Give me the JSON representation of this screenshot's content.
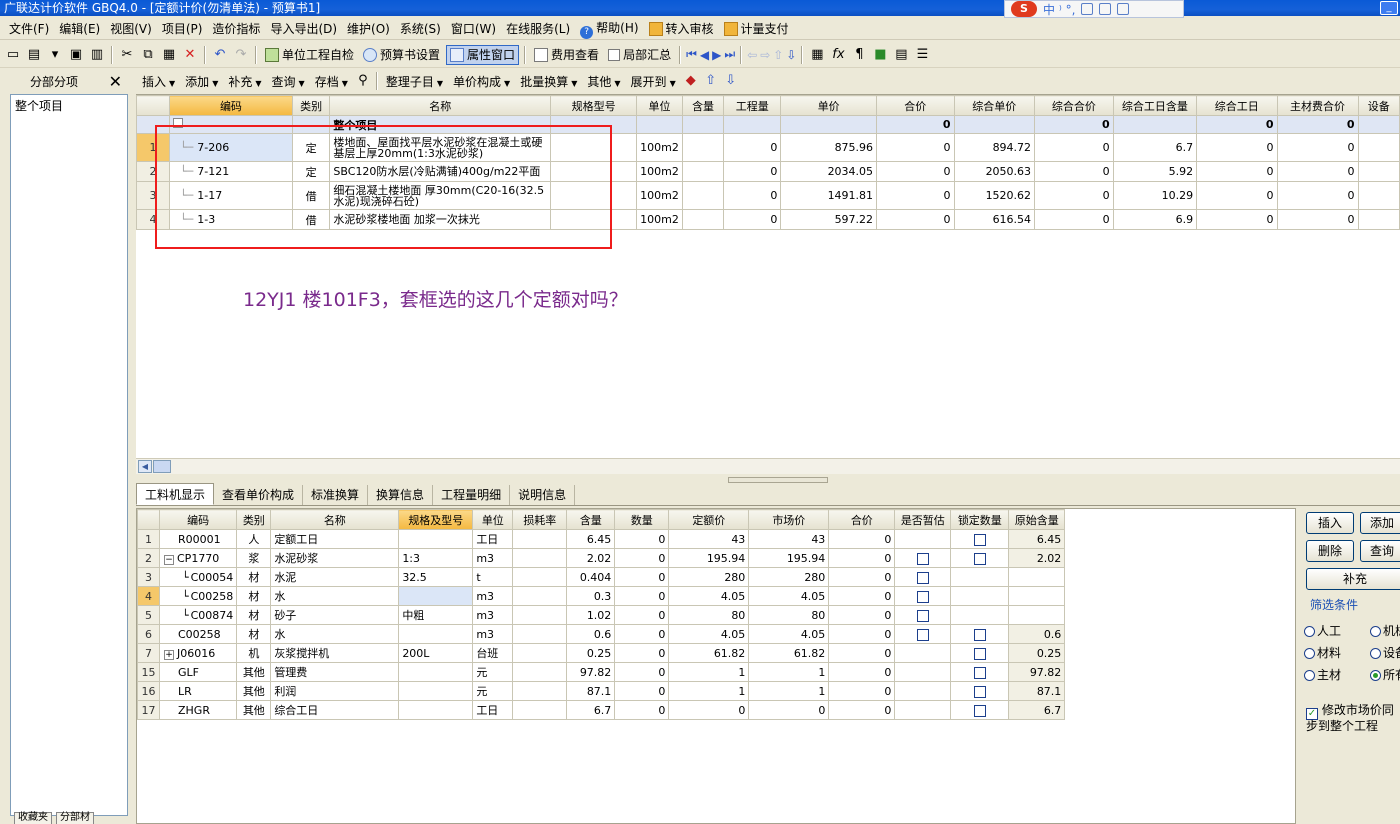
{
  "title": "广联达计价软件 GBQ4.0 - [定额计价(勿清单法) - 预算书1]",
  "ime": {
    "text": "中 ⁾ °,"
  },
  "menu": [
    "文件(F)",
    "编辑(E)",
    "视图(V)",
    "项目(P)",
    "造价指标",
    "导入导出(D)",
    "维护(O)",
    "系统(S)",
    "窗口(W)",
    "在线服务(L)",
    "帮助(H)",
    "转入审核",
    "计量支付"
  ],
  "toolbar1": {
    "self_check": "单位工程自检",
    "budget_settings": "预算书设置",
    "property_window": "属性窗口",
    "fee_view": "费用查看",
    "partial_summary": "局部汇总"
  },
  "left_panel": {
    "title": "分部分项",
    "tree_root": "整个项目",
    "bottom_tabs": [
      "收藏夹",
      "分部材"
    ]
  },
  "subtoolbar": [
    "插入",
    "添加",
    "补充",
    "查询",
    "存档",
    "整理子目",
    "单价构成",
    "批量换算",
    "其他",
    "展开到"
  ],
  "upper_grid": {
    "columns": [
      "编码",
      "类别",
      "名称",
      "规格型号",
      "单位",
      "含量",
      "工程量",
      "单价",
      "合价",
      "综合单价",
      "综合合价",
      "综合工日含量",
      "综合工日",
      "主材费合价",
      "设备"
    ],
    "total_row": {
      "name": "整个项目",
      "hejia": "0",
      "zonghe_hejia": "0",
      "zonghe_gongri": "0",
      "zhucai": "0"
    },
    "rows": [
      {
        "num": "1",
        "code": "7-206",
        "type": "定",
        "name": "楼地面、屋面找平层水泥砂浆在混凝土或硬基层上厚20mm(1:3水泥砂浆)",
        "unit": "100m2",
        "qty": "0",
        "price": "875.96",
        "total": "0",
        "unit_comp": "894.72",
        "total_comp": "0",
        "labor_per": "6.7",
        "labor": "0",
        "material": "0"
      },
      {
        "num": "2",
        "code": "7-121",
        "type": "定",
        "name": "SBC120防水层(冷贴满铺)400g/m22平面",
        "unit": "100m2",
        "qty": "0",
        "price": "2034.05",
        "total": "0",
        "unit_comp": "2050.63",
        "total_comp": "0",
        "labor_per": "5.92",
        "labor": "0",
        "material": "0"
      },
      {
        "num": "3",
        "code": "1-17",
        "type": "借",
        "name": "细石混凝土楼地面 厚30mm(C20-16(32.5水泥)现浇碎石砼)",
        "unit": "100m2",
        "qty": "0",
        "price": "1491.81",
        "total": "0",
        "unit_comp": "1520.62",
        "total_comp": "0",
        "labor_per": "10.29",
        "labor": "0",
        "material": "0"
      },
      {
        "num": "4",
        "code": "1-3",
        "type": "借",
        "name": "水泥砂浆楼地面 加浆一次抹光",
        "unit": "100m2",
        "qty": "0",
        "price": "597.22",
        "total": "0",
        "unit_comp": "616.54",
        "total_comp": "0",
        "labor_per": "6.9",
        "labor": "0",
        "material": "0"
      }
    ]
  },
  "annotation": {
    "question": "12YJ1 楼101F3，套框选的这几个定额对吗？"
  },
  "lower_tabs": [
    "工料机显示",
    "查看单价构成",
    "标准换算",
    "换算信息",
    "工程量明细",
    "说明信息"
  ],
  "lower_grid": {
    "columns": [
      "编码",
      "类别",
      "名称",
      "规格及型号",
      "单位",
      "损耗率",
      "含量",
      "数量",
      "定额价",
      "市场价",
      "合价",
      "是否暂估",
      "锁定数量",
      "原始含量"
    ],
    "rows": [
      {
        "num": "1",
        "code": "R00001",
        "type": "人",
        "name": "定额工日",
        "spec": "",
        "unit": "工日",
        "loss": "",
        "content": "6.45",
        "qty": "0",
        "base": "43",
        "market": "43",
        "total": "0",
        "temp": false,
        "lock": true,
        "origin": "6.45",
        "indent": 0,
        "expander": ""
      },
      {
        "num": "2",
        "code": "CP1770",
        "type": "浆",
        "name": "水泥砂浆",
        "spec": "1:3",
        "unit": "m3",
        "loss": "",
        "content": "2.02",
        "qty": "0",
        "base": "195.94",
        "market": "195.94",
        "total": "0",
        "temp": true,
        "lock": true,
        "origin": "2.02",
        "indent": 0,
        "expander": "−"
      },
      {
        "num": "3",
        "code": "C00054",
        "type": "材",
        "name": "水泥",
        "spec": "32.5",
        "unit": "t",
        "loss": "",
        "content": "0.404",
        "qty": "0",
        "base": "280",
        "market": "280",
        "total": "0",
        "temp": true,
        "lock": false,
        "origin": "",
        "indent": 1,
        "expander": ""
      },
      {
        "num": "4",
        "code": "C00258",
        "type": "材",
        "name": "水",
        "spec": "",
        "unit": "m3",
        "loss": "",
        "content": "0.3",
        "qty": "0",
        "base": "4.05",
        "market": "4.05",
        "total": "0",
        "temp": true,
        "lock": false,
        "origin": "",
        "indent": 1,
        "expander": ""
      },
      {
        "num": "5",
        "code": "C00874",
        "type": "材",
        "name": "砂子",
        "spec": "中粗",
        "unit": "m3",
        "loss": "",
        "content": "1.02",
        "qty": "0",
        "base": "80",
        "market": "80",
        "total": "0",
        "temp": true,
        "lock": false,
        "origin": "",
        "indent": 1,
        "expander": ""
      },
      {
        "num": "6",
        "code": "C00258",
        "type": "材",
        "name": "水",
        "spec": "",
        "unit": "m3",
        "loss": "",
        "content": "0.6",
        "qty": "0",
        "base": "4.05",
        "market": "4.05",
        "total": "0",
        "temp": true,
        "lock": true,
        "origin": "0.6",
        "indent": 0,
        "expander": ""
      },
      {
        "num": "7",
        "code": "J06016",
        "type": "机",
        "name": "灰浆搅拌机",
        "spec": "200L",
        "unit": "台班",
        "loss": "",
        "content": "0.25",
        "qty": "0",
        "base": "61.82",
        "market": "61.82",
        "total": "0",
        "temp": false,
        "lock": true,
        "origin": "0.25",
        "indent": 0,
        "expander": "+"
      },
      {
        "num": "15",
        "code": "GLF",
        "type": "其他",
        "name": "管理费",
        "spec": "",
        "unit": "元",
        "loss": "",
        "content": "97.82",
        "qty": "0",
        "base": "1",
        "market": "1",
        "total": "0",
        "temp": false,
        "lock": true,
        "origin": "97.82",
        "indent": 0,
        "expander": ""
      },
      {
        "num": "16",
        "code": "LR",
        "type": "其他",
        "name": "利润",
        "spec": "",
        "unit": "元",
        "loss": "",
        "content": "87.1",
        "qty": "0",
        "base": "1",
        "market": "1",
        "total": "0",
        "temp": false,
        "lock": true,
        "origin": "87.1",
        "indent": 0,
        "expander": ""
      },
      {
        "num": "17",
        "code": "ZHGR",
        "type": "其他",
        "name": "综合工日",
        "spec": "",
        "unit": "工日",
        "loss": "",
        "content": "6.7",
        "qty": "0",
        "base": "0",
        "market": "0",
        "total": "0",
        "temp": false,
        "lock": true,
        "origin": "6.7",
        "indent": 0,
        "expander": ""
      }
    ]
  },
  "right_panel": {
    "insert": "插入",
    "add": "添加",
    "delete": "删除",
    "query": "查询",
    "supplement": "补充",
    "filter_title": "筛选条件",
    "filters": [
      "人工",
      "机械",
      "材料",
      "设备",
      "主材",
      "所有"
    ],
    "sync_label": "修改市场价同步到整个工程"
  }
}
